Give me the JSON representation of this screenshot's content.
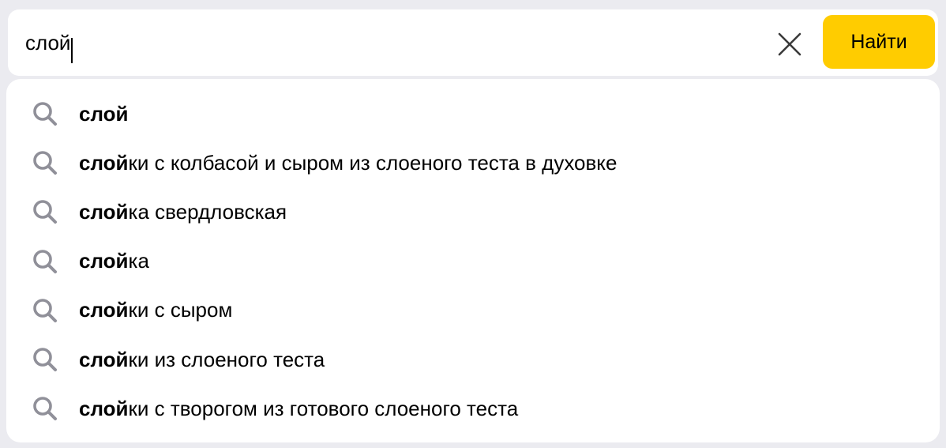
{
  "search": {
    "value": "слой",
    "placeholder": ""
  },
  "buttons": {
    "find_label": "Найти",
    "clear_icon": "close-icon"
  },
  "colors": {
    "accent": "#ffcc00",
    "icon_gray": "#909099",
    "background": "#ebebf0"
  },
  "suggestions": [
    {
      "match": "слой",
      "rest": ""
    },
    {
      "match": "слой",
      "rest": "ки с колбасой и сыром из слоеного теста в духовке"
    },
    {
      "match": "слой",
      "rest": "ка свердловская"
    },
    {
      "match": "слой",
      "rest": "ка"
    },
    {
      "match": "слой",
      "rest": "ки с сыром"
    },
    {
      "match": "слой",
      "rest": "ки из слоеного теста"
    },
    {
      "match": "слой",
      "rest": "ки с творогом из готового слоеного теста"
    }
  ]
}
